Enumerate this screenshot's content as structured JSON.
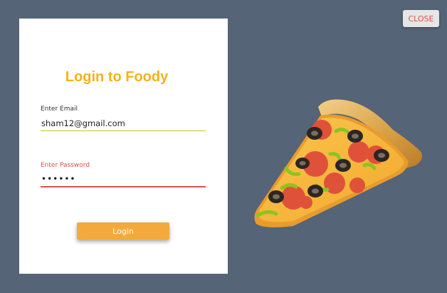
{
  "login": {
    "title": "Login to Foody",
    "email_label": "Enter Email",
    "email_value": "sham12@gmail.com",
    "password_label": "Enter Password",
    "password_value": "••••••",
    "button_label": "Login"
  },
  "close_button": {
    "label": "CLOSE"
  },
  "illustration": {
    "icon": "pizza-slice-icon"
  },
  "colors": {
    "background": "#556476",
    "title_accent": "#f4b21b",
    "login_button": "#f3a93c",
    "error_red": "#d9534f",
    "email_underline": "#c9c02c"
  }
}
